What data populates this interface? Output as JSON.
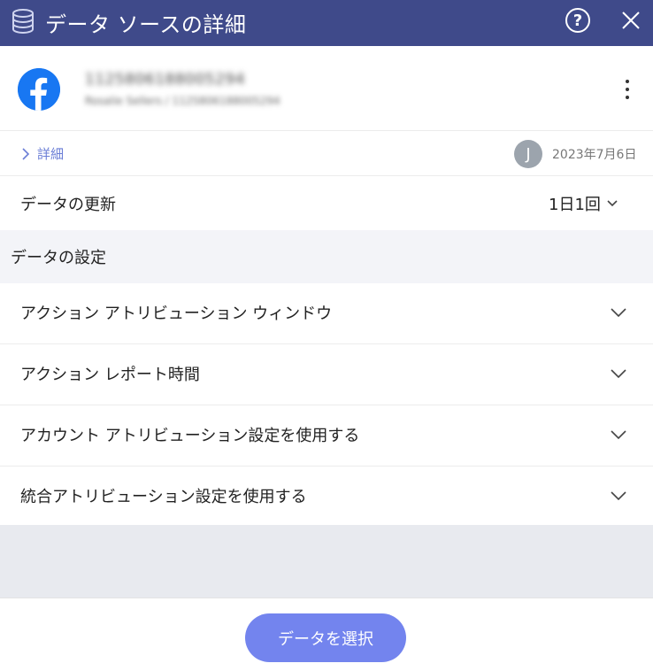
{
  "window": {
    "title": "データ ソースの詳細",
    "help_label": "?",
    "title_icon": "database-icon",
    "close_icon": "close-icon"
  },
  "account": {
    "platform_icon": "facebook-icon",
    "name": "1125806188005294",
    "subtitle": "Rosalie Sellers / 1125806188005294",
    "menu_icon": "more-vertical-icon"
  },
  "details": {
    "link_label": "詳細",
    "avatar_initial": "J",
    "date": "2023年7月6日"
  },
  "refresh": {
    "label": "データの更新",
    "value": "1日1回"
  },
  "section": {
    "title": "データの設定"
  },
  "settings": [
    {
      "label": "アクション アトリビューション ウィンドウ"
    },
    {
      "label": "アクション レポート時間"
    },
    {
      "label": "アカウント アトリビューション設定を使用する"
    },
    {
      "label": "統合アトリビューション設定を使用する"
    }
  ],
  "footer": {
    "select_button": "データを選択"
  },
  "colors": {
    "titlebar": "#3f4a8a",
    "facebook": "#1877f2",
    "link": "#6b7ed6",
    "primary_button": "#7384ee"
  }
}
